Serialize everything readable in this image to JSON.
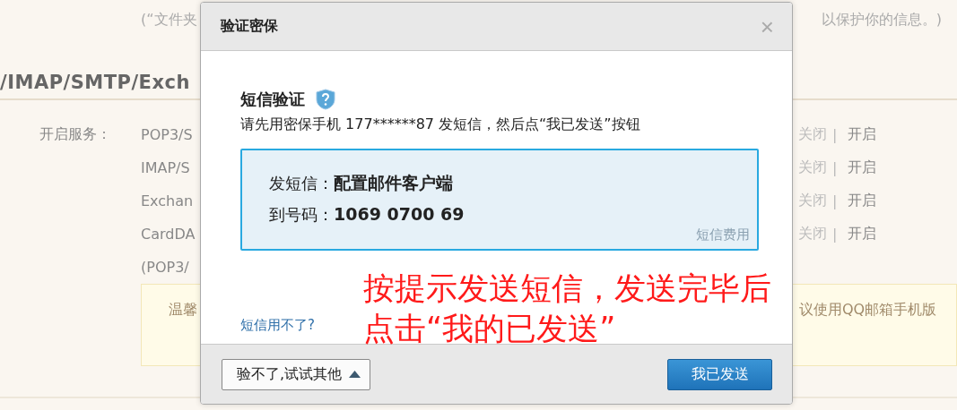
{
  "background": {
    "note_left": "(“文件夹",
    "note_right": "以保护你的信息。)",
    "heading": "/IMAP/SMTP/Exch",
    "service_label": "开启服务：",
    "services": [
      {
        "name": "POP3/S",
        "off": "关闭",
        "separator": "|",
        "on": "开启"
      },
      {
        "name": "IMAP/S",
        "off": "关闭",
        "separator": "|",
        "on": "开启"
      },
      {
        "name": "Exchan",
        "off": "关闭",
        "separator": "|",
        "on": "开启"
      },
      {
        "name": "CardDA",
        "off": "关闭",
        "separator": "|",
        "on": "开启"
      }
    ],
    "footnote": "(POP3/",
    "notice_left": "温馨",
    "notice_right": "议使用QQ邮箱手机版"
  },
  "dialog": {
    "title": "验证密保",
    "close": "×",
    "section_title": "短信验证",
    "instruction": "请先用密保手机 177******87 发短信，然后点“我已发送”按钮",
    "sms": [
      {
        "label": "发短信：",
        "value": "配置邮件客户端"
      },
      {
        "label": "到号码：",
        "value": "1069 0700 69"
      }
    ],
    "fee_link": "短信费用",
    "help_link": "短信用不了?",
    "alt_button": "验不了,试试其他",
    "confirm_button": "我已发送"
  },
  "annotation": [
    "按提示发送短信，发送完毕后",
    "点击“我的已发送”"
  ]
}
